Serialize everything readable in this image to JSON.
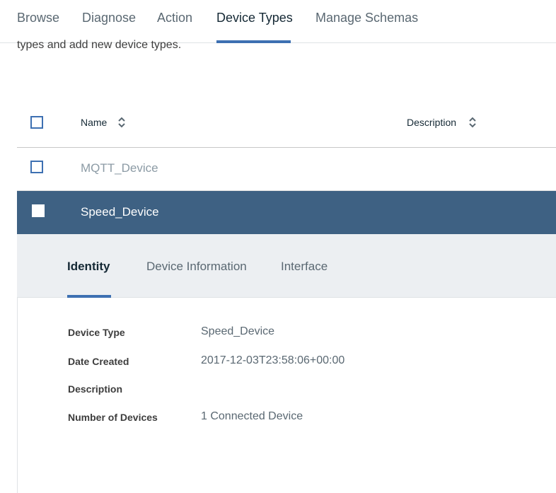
{
  "nav": {
    "tabs": [
      "Browse",
      "Diagnose",
      "Action",
      "Device Types",
      "Manage Schemas"
    ],
    "active": "Device Types"
  },
  "intro_text": "types and add new device types.",
  "table": {
    "headers": {
      "name": "Name",
      "description": "Description"
    },
    "rows": [
      {
        "name": "MQTT_Device",
        "selected": false
      },
      {
        "name": "Speed_Device",
        "selected": true
      }
    ]
  },
  "detail": {
    "tabs": [
      "Identity",
      "Device Information",
      "Interface"
    ],
    "active_tab": "Identity",
    "fields": [
      {
        "label": "Device Type",
        "value": "Speed_Device"
      },
      {
        "label": "Date Created",
        "value": "2017-12-03T23:58:06+00:00"
      },
      {
        "label": "Description",
        "value": ""
      },
      {
        "label": "Number of Devices",
        "value": "1 Connected Device"
      }
    ]
  },
  "colors": {
    "accent": "#3d70b2",
    "selected_row": "#3e6183",
    "detail_bg": "#eceff2"
  }
}
